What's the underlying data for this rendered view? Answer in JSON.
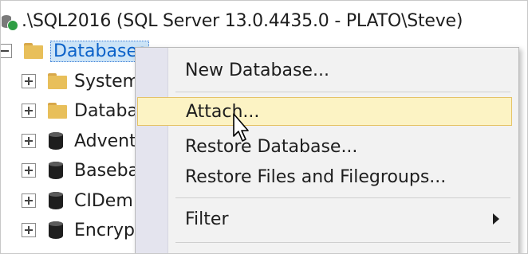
{
  "server": {
    "label": ".\\SQL2016 (SQL Server 13.0.4435.0 - PLATO\\Steve)",
    "status_icon": "server-connected-icon"
  },
  "tree": {
    "databases_label": "Databases",
    "children": [
      {
        "label": "System",
        "kind": "folder"
      },
      {
        "label": "Databa",
        "kind": "folder"
      },
      {
        "label": "Advent",
        "kind": "database"
      },
      {
        "label": "Baseba",
        "kind": "database"
      },
      {
        "label": "CIDem",
        "kind": "database"
      },
      {
        "label": "Encrypt",
        "kind": "database"
      }
    ]
  },
  "context_menu": {
    "items": [
      {
        "label": "New Database..."
      },
      {
        "label": "Attach...",
        "highlighted": true
      },
      {
        "label": "Restore Database..."
      },
      {
        "label": "Restore Files and Filegroups..."
      },
      {
        "label": "Filter",
        "has_submenu": true
      }
    ]
  },
  "colors": {
    "highlight_bg": "#fcf3c4",
    "highlight_border": "#e5c365",
    "selection_bg": "#cce4f7",
    "selection_text": "#0b62c9"
  }
}
